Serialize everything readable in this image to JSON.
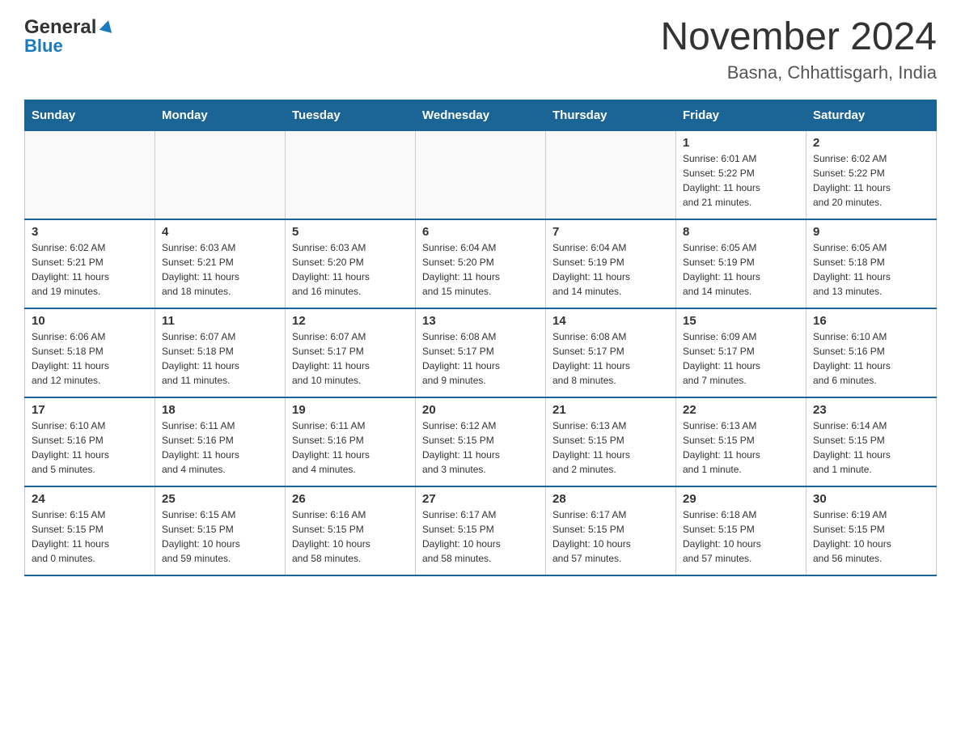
{
  "header": {
    "logo_general": "General",
    "logo_blue": "Blue",
    "title": "November 2024",
    "subtitle": "Basna, Chhattisgarh, India"
  },
  "calendar": {
    "days_of_week": [
      "Sunday",
      "Monday",
      "Tuesday",
      "Wednesday",
      "Thursday",
      "Friday",
      "Saturday"
    ],
    "weeks": [
      [
        {
          "day": "",
          "info": ""
        },
        {
          "day": "",
          "info": ""
        },
        {
          "day": "",
          "info": ""
        },
        {
          "day": "",
          "info": ""
        },
        {
          "day": "",
          "info": ""
        },
        {
          "day": "1",
          "info": "Sunrise: 6:01 AM\nSunset: 5:22 PM\nDaylight: 11 hours\nand 21 minutes."
        },
        {
          "day": "2",
          "info": "Sunrise: 6:02 AM\nSunset: 5:22 PM\nDaylight: 11 hours\nand 20 minutes."
        }
      ],
      [
        {
          "day": "3",
          "info": "Sunrise: 6:02 AM\nSunset: 5:21 PM\nDaylight: 11 hours\nand 19 minutes."
        },
        {
          "day": "4",
          "info": "Sunrise: 6:03 AM\nSunset: 5:21 PM\nDaylight: 11 hours\nand 18 minutes."
        },
        {
          "day": "5",
          "info": "Sunrise: 6:03 AM\nSunset: 5:20 PM\nDaylight: 11 hours\nand 16 minutes."
        },
        {
          "day": "6",
          "info": "Sunrise: 6:04 AM\nSunset: 5:20 PM\nDaylight: 11 hours\nand 15 minutes."
        },
        {
          "day": "7",
          "info": "Sunrise: 6:04 AM\nSunset: 5:19 PM\nDaylight: 11 hours\nand 14 minutes."
        },
        {
          "day": "8",
          "info": "Sunrise: 6:05 AM\nSunset: 5:19 PM\nDaylight: 11 hours\nand 14 minutes."
        },
        {
          "day": "9",
          "info": "Sunrise: 6:05 AM\nSunset: 5:18 PM\nDaylight: 11 hours\nand 13 minutes."
        }
      ],
      [
        {
          "day": "10",
          "info": "Sunrise: 6:06 AM\nSunset: 5:18 PM\nDaylight: 11 hours\nand 12 minutes."
        },
        {
          "day": "11",
          "info": "Sunrise: 6:07 AM\nSunset: 5:18 PM\nDaylight: 11 hours\nand 11 minutes."
        },
        {
          "day": "12",
          "info": "Sunrise: 6:07 AM\nSunset: 5:17 PM\nDaylight: 11 hours\nand 10 minutes."
        },
        {
          "day": "13",
          "info": "Sunrise: 6:08 AM\nSunset: 5:17 PM\nDaylight: 11 hours\nand 9 minutes."
        },
        {
          "day": "14",
          "info": "Sunrise: 6:08 AM\nSunset: 5:17 PM\nDaylight: 11 hours\nand 8 minutes."
        },
        {
          "day": "15",
          "info": "Sunrise: 6:09 AM\nSunset: 5:17 PM\nDaylight: 11 hours\nand 7 minutes."
        },
        {
          "day": "16",
          "info": "Sunrise: 6:10 AM\nSunset: 5:16 PM\nDaylight: 11 hours\nand 6 minutes."
        }
      ],
      [
        {
          "day": "17",
          "info": "Sunrise: 6:10 AM\nSunset: 5:16 PM\nDaylight: 11 hours\nand 5 minutes."
        },
        {
          "day": "18",
          "info": "Sunrise: 6:11 AM\nSunset: 5:16 PM\nDaylight: 11 hours\nand 4 minutes."
        },
        {
          "day": "19",
          "info": "Sunrise: 6:11 AM\nSunset: 5:16 PM\nDaylight: 11 hours\nand 4 minutes."
        },
        {
          "day": "20",
          "info": "Sunrise: 6:12 AM\nSunset: 5:15 PM\nDaylight: 11 hours\nand 3 minutes."
        },
        {
          "day": "21",
          "info": "Sunrise: 6:13 AM\nSunset: 5:15 PM\nDaylight: 11 hours\nand 2 minutes."
        },
        {
          "day": "22",
          "info": "Sunrise: 6:13 AM\nSunset: 5:15 PM\nDaylight: 11 hours\nand 1 minute."
        },
        {
          "day": "23",
          "info": "Sunrise: 6:14 AM\nSunset: 5:15 PM\nDaylight: 11 hours\nand 1 minute."
        }
      ],
      [
        {
          "day": "24",
          "info": "Sunrise: 6:15 AM\nSunset: 5:15 PM\nDaylight: 11 hours\nand 0 minutes."
        },
        {
          "day": "25",
          "info": "Sunrise: 6:15 AM\nSunset: 5:15 PM\nDaylight: 10 hours\nand 59 minutes."
        },
        {
          "day": "26",
          "info": "Sunrise: 6:16 AM\nSunset: 5:15 PM\nDaylight: 10 hours\nand 58 minutes."
        },
        {
          "day": "27",
          "info": "Sunrise: 6:17 AM\nSunset: 5:15 PM\nDaylight: 10 hours\nand 58 minutes."
        },
        {
          "day": "28",
          "info": "Sunrise: 6:17 AM\nSunset: 5:15 PM\nDaylight: 10 hours\nand 57 minutes."
        },
        {
          "day": "29",
          "info": "Sunrise: 6:18 AM\nSunset: 5:15 PM\nDaylight: 10 hours\nand 57 minutes."
        },
        {
          "day": "30",
          "info": "Sunrise: 6:19 AM\nSunset: 5:15 PM\nDaylight: 10 hours\nand 56 minutes."
        }
      ]
    ]
  }
}
